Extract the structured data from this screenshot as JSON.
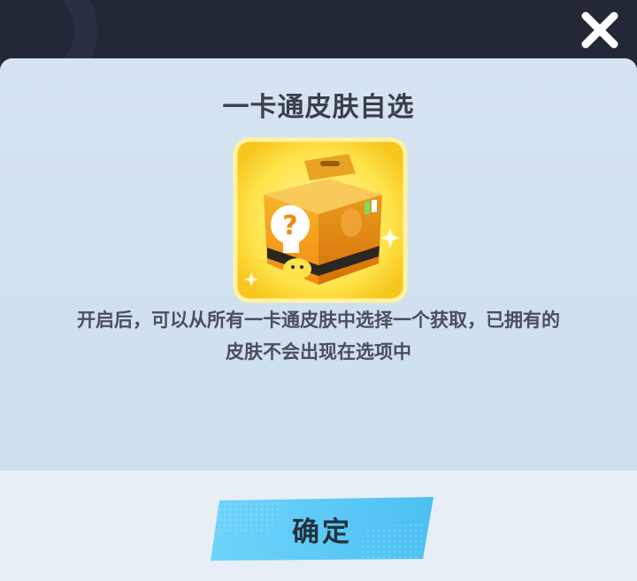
{
  "dialog": {
    "title": "一卡通皮肤自选",
    "description_line1": "开启后，可以从所有一卡通皮肤中选择一个获取，已拥有的",
    "description_line2": "皮肤不会出现在选项中",
    "confirm_label": "确定"
  },
  "item": {
    "icon": "mystery-skin-box-icon",
    "rarity_color": "#ffe24a"
  },
  "icons": {
    "close": "close-icon"
  },
  "colors": {
    "panel": "#cfe0ee",
    "button": "#5cc8f5",
    "title_text": "#3b3f4a"
  }
}
